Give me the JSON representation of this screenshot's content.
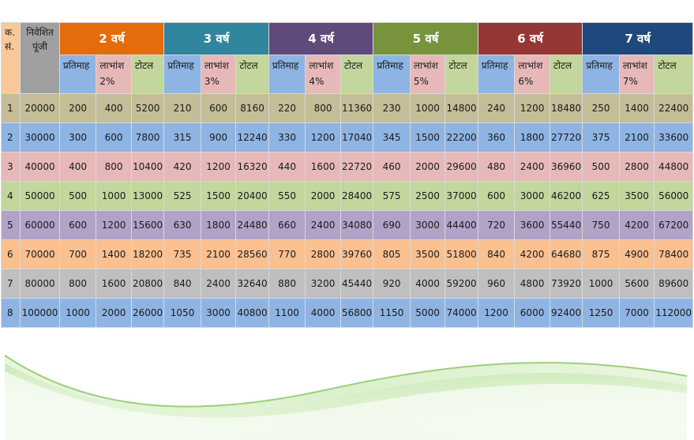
{
  "header": {
    "sn_label": "क. सं.",
    "capital_label": "निवेशित पूंजी"
  },
  "col_labels": [
    "प्रतिमाह",
    "लाभांश",
    "टोटल"
  ],
  "groups": [
    {
      "title": "2 वर्ष",
      "percent": "2%",
      "color": "#e46c0a"
    },
    {
      "title": "3 वर्ष",
      "percent": "3%",
      "color": "#31859c"
    },
    {
      "title": "4 वर्ष",
      "percent": "4%",
      "color": "#604a7b"
    },
    {
      "title": "5 वर्ष",
      "percent": "5%",
      "color": "#77933c"
    },
    {
      "title": "6 वर्ष",
      "percent": "6%",
      "color": "#953735"
    },
    {
      "title": "7 वर्ष",
      "percent": "7%",
      "color": "#1f497d"
    }
  ],
  "sub_colors": [
    "#8eb4e3",
    "#e6b9b8",
    "#c3d69b"
  ],
  "rows": [
    {
      "sn": "1",
      "capital": "20000",
      "color": "#c4bd97",
      "values": [
        "200",
        "400",
        "5200",
        "210",
        "600",
        "8160",
        "220",
        "800",
        "11360",
        "230",
        "1000",
        "14800",
        "240",
        "1200",
        "18480",
        "250",
        "1400",
        "22400"
      ]
    },
    {
      "sn": "2",
      "capital": "30000",
      "color": "#8eb4e3",
      "values": [
        "300",
        "600",
        "7800",
        "315",
        "900",
        "12240",
        "330",
        "1200",
        "17040",
        "345",
        "1500",
        "22200",
        "360",
        "1800",
        "27720",
        "375",
        "2100",
        "33600"
      ]
    },
    {
      "sn": "3",
      "capital": "40000",
      "color": "#e6b9b8",
      "values": [
        "400",
        "800",
        "10400",
        "420",
        "1200",
        "16320",
        "440",
        "1600",
        "22720",
        "460",
        "2000",
        "29600",
        "480",
        "2400",
        "36960",
        "500",
        "2800",
        "44800"
      ]
    },
    {
      "sn": "4",
      "capital": "50000",
      "color": "#c3d69b",
      "values": [
        "500",
        "1000",
        "13000",
        "525",
        "1500",
        "20400",
        "550",
        "2000",
        "28400",
        "575",
        "2500",
        "37000",
        "600",
        "3000",
        "46200",
        "625",
        "3500",
        "56000"
      ]
    },
    {
      "sn": "5",
      "capital": "60000",
      "color": "#b3a2c7",
      "values": [
        "600",
        "1200",
        "15600",
        "630",
        "1800",
        "24480",
        "660",
        "2400",
        "34080",
        "690",
        "3000",
        "44400",
        "720",
        "3600",
        "55440",
        "750",
        "4200",
        "67200"
      ]
    },
    {
      "sn": "6",
      "capital": "70000",
      "color": "#fac090",
      "values": [
        "700",
        "1400",
        "18200",
        "735",
        "2100",
        "28560",
        "770",
        "2800",
        "39760",
        "805",
        "3500",
        "51800",
        "840",
        "4200",
        "64680",
        "875",
        "4900",
        "78400"
      ]
    },
    {
      "sn": "7",
      "capital": "80000",
      "color": "#bfbfbf",
      "values": [
        "800",
        "1600",
        "20800",
        "840",
        "2400",
        "32640",
        "880",
        "3200",
        "45440",
        "920",
        "4000",
        "59200",
        "960",
        "4800",
        "73920",
        "1000",
        "5600",
        "89600"
      ]
    },
    {
      "sn": "8",
      "capital": "100000",
      "color": "#8eb4e3",
      "values": [
        "1000",
        "2000",
        "26000",
        "1050",
        "3000",
        "40800",
        "1100",
        "4000",
        "56800",
        "1150",
        "5000",
        "74000",
        "1200",
        "6000",
        "92400",
        "1250",
        "7000",
        "112000"
      ]
    }
  ]
}
